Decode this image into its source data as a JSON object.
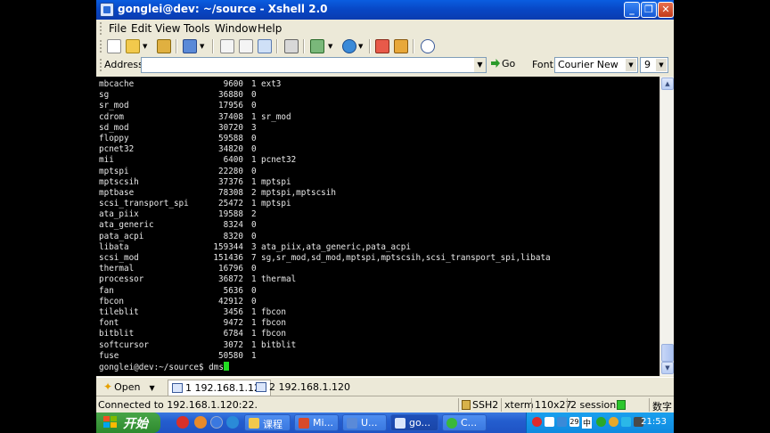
{
  "window": {
    "title": "gonglei@dev: ~/source - Xshell 2.0",
    "minimize_glyph": "_",
    "maximize_glyph": "❐",
    "close_glyph": "✕"
  },
  "menu": [
    "File",
    "Edit",
    "View",
    "Tools",
    "Window",
    "Help"
  ],
  "address": {
    "label": "Address",
    "value": "",
    "go_label": "Go",
    "font_label": "Font",
    "font_value": "Courier New",
    "size_value": "9"
  },
  "terminal": {
    "rows": [
      [
        "mbcache",
        "9600",
        "1",
        "ext3"
      ],
      [
        "sg",
        "36880",
        "0",
        ""
      ],
      [
        "sr_mod",
        "17956",
        "0",
        ""
      ],
      [
        "cdrom",
        "37408",
        "1",
        "sr_mod"
      ],
      [
        "sd_mod",
        "30720",
        "3",
        ""
      ],
      [
        "floppy",
        "59588",
        "0",
        ""
      ],
      [
        "pcnet32",
        "34820",
        "0",
        ""
      ],
      [
        "mii",
        "6400",
        "1",
        "pcnet32"
      ],
      [
        "mptspi",
        "22280",
        "0",
        ""
      ],
      [
        "mptscsih",
        "37376",
        "1",
        "mptspi"
      ],
      [
        "mptbase",
        "78308",
        "2",
        "mptspi,mptscsih"
      ],
      [
        "scsi_transport_spi",
        "25472",
        "1",
        "mptspi"
      ],
      [
        "ata_piix",
        "19588",
        "2",
        ""
      ],
      [
        "ata_generic",
        "8324",
        "0",
        ""
      ],
      [
        "pata_acpi",
        "8320",
        "0",
        ""
      ],
      [
        "libata",
        "159344",
        "3",
        "ata_piix,ata_generic,pata_acpi"
      ],
      [
        "scsi_mod",
        "151436",
        "7",
        "sg,sr_mod,sd_mod,mptspi,mptscsih,scsi_transport_spi,libata"
      ],
      [
        "thermal",
        "16796",
        "0",
        ""
      ],
      [
        "processor",
        "36872",
        "1",
        "thermal"
      ],
      [
        "fan",
        "5636",
        "0",
        ""
      ],
      [
        "fbcon",
        "42912",
        "0",
        ""
      ],
      [
        "tileblit",
        "3456",
        "1",
        "fbcon"
      ],
      [
        "font",
        "9472",
        "1",
        "fbcon"
      ],
      [
        "bitblit",
        "6784",
        "1",
        "fbcon"
      ],
      [
        "softcursor",
        "3072",
        "1",
        "bitblit"
      ],
      [
        "fuse",
        "50580",
        "1",
        ""
      ]
    ],
    "prompt": "gonglei@dev:~/source$ ",
    "input": "dms"
  },
  "tabs": {
    "open_label": "Open",
    "items": [
      {
        "label": "1 192.168.1.120"
      },
      {
        "label": "2 192.168.1.120"
      }
    ]
  },
  "status": {
    "connection": "Connected to 192.168.1.120:22.",
    "protocol": "SSH2",
    "terminal_type": "xterm",
    "size": "110x27",
    "sessions": "2 sessions",
    "ime": "数字"
  },
  "taskbar": {
    "start_label": "开始",
    "tasks": [
      "课程",
      "Mi...",
      "U...",
      "go...",
      "C..."
    ],
    "tray_date": "29",
    "clock": "21:53",
    "tray_ime": "中"
  }
}
